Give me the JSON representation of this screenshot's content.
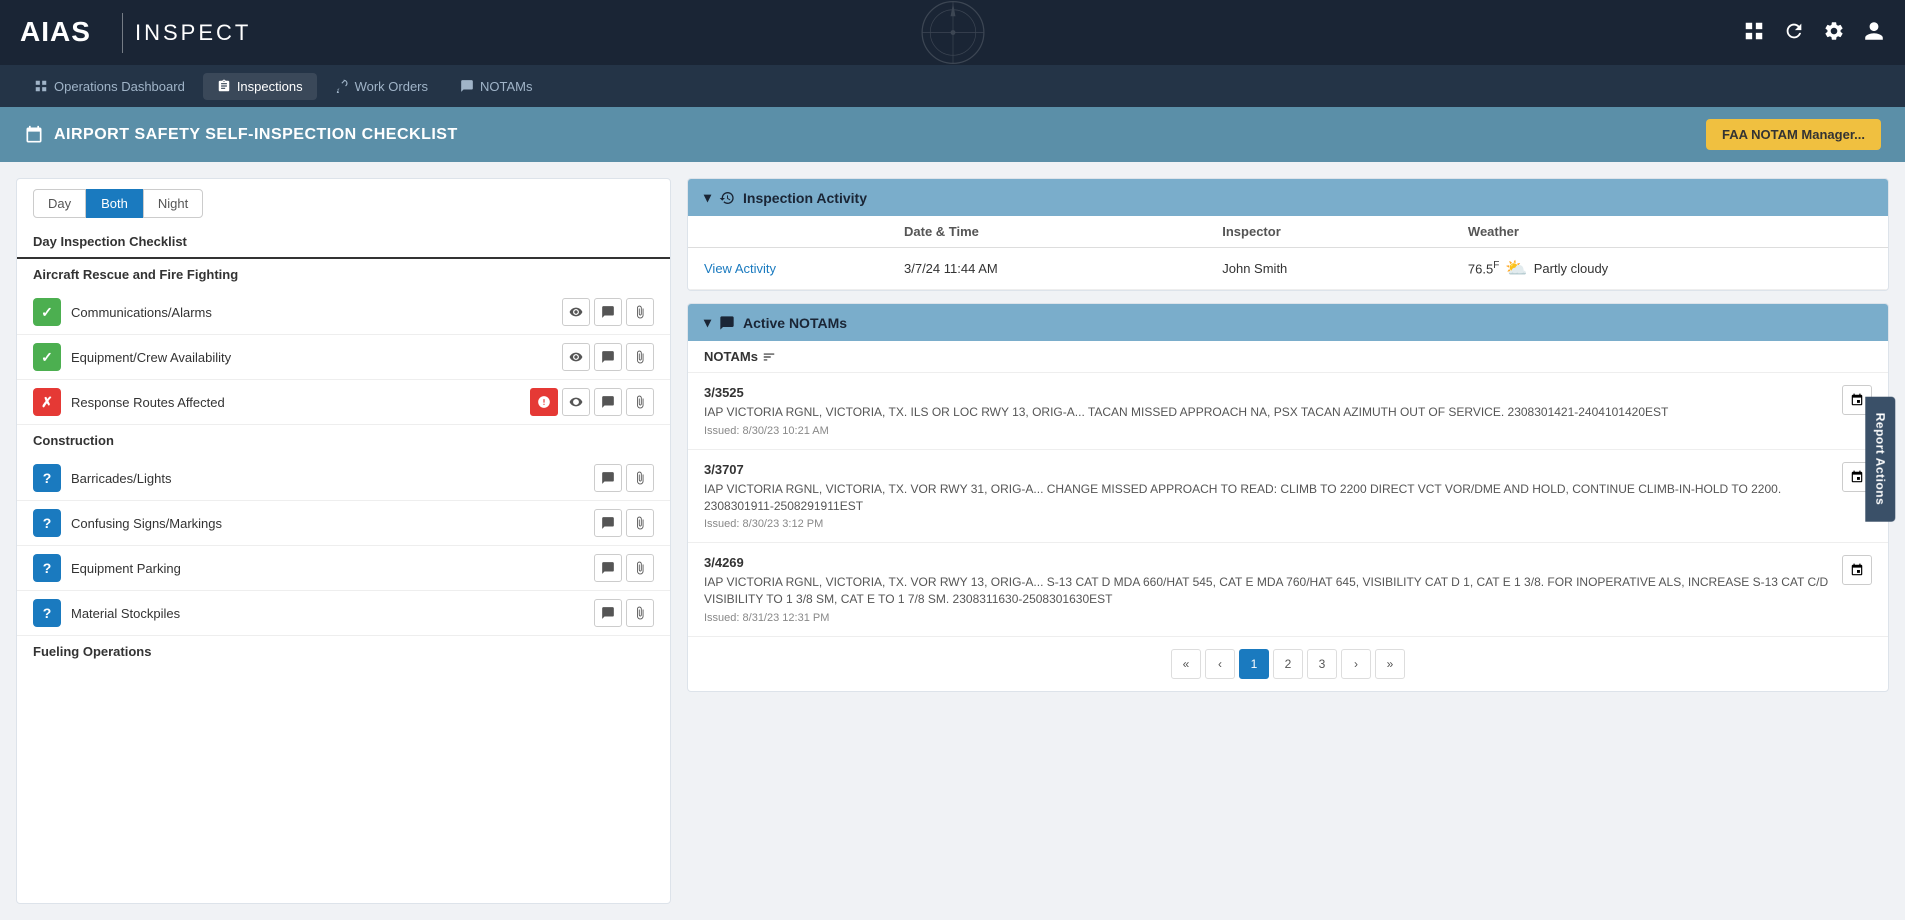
{
  "app": {
    "logo": "AIAS",
    "product": "INSPECT"
  },
  "nav": {
    "items": [
      {
        "id": "operations",
        "label": "Operations Dashboard",
        "icon": "grid-icon",
        "active": false
      },
      {
        "id": "inspections",
        "label": "Inspections",
        "icon": "clipboard-icon",
        "active": true
      },
      {
        "id": "workorders",
        "label": "Work Orders",
        "icon": "wrench-icon",
        "active": false
      },
      {
        "id": "notams",
        "label": "NOTAMs",
        "icon": "chat-icon",
        "active": false
      }
    ]
  },
  "page_header": {
    "title": "AIRPORT SAFETY SELF-INSPECTION CHECKLIST",
    "faa_btn": "FAA NOTAM Manager..."
  },
  "checklist": {
    "filter_buttons": [
      {
        "id": "day",
        "label": "Day",
        "active": false
      },
      {
        "id": "both",
        "label": "Both",
        "active": true
      },
      {
        "id": "night",
        "label": "Night",
        "active": false
      }
    ],
    "title": "Day Inspection Checklist",
    "sections": [
      {
        "id": "arff",
        "label": "Aircraft Rescue and Fire Fighting",
        "items": [
          {
            "id": "comm-alarms",
            "label": "Communications/Alarms",
            "status": "pass",
            "status_symbol": "✓"
          },
          {
            "id": "equip-crew",
            "label": "Equipment/Crew Availability",
            "status": "pass",
            "status_symbol": "✓"
          },
          {
            "id": "response-routes",
            "label": "Response Routes Affected",
            "status": "fail",
            "status_symbol": "✗"
          }
        ]
      },
      {
        "id": "construction",
        "label": "Construction",
        "items": [
          {
            "id": "barricades",
            "label": "Barricades/Lights",
            "status": "unknown",
            "status_symbol": "?"
          },
          {
            "id": "confusing-signs",
            "label": "Confusing Signs/Markings",
            "status": "unknown",
            "status_symbol": "?"
          },
          {
            "id": "equip-parking",
            "label": "Equipment Parking",
            "status": "unknown",
            "status_symbol": "?"
          },
          {
            "id": "material-stockpiles",
            "label": "Material Stockpiles",
            "status": "unknown",
            "status_symbol": "?"
          }
        ]
      },
      {
        "id": "fueling",
        "label": "Fueling Operations"
      }
    ]
  },
  "inspection_activity": {
    "section_title": "Inspection Activity",
    "columns": [
      "Date & Time",
      "Inspector",
      "Weather"
    ],
    "rows": [
      {
        "link_label": "View Activity",
        "date_time": "3/7/24 11:44 AM",
        "inspector": "John Smith",
        "temperature": "76.5",
        "temp_unit": "F",
        "weather_desc": "Partly cloudy"
      }
    ]
  },
  "active_notams": {
    "section_title": "Active NOTAMs",
    "filter_label": "NOTAMs",
    "notams": [
      {
        "id": "3/3525",
        "text": "IAP VICTORIA RGNL, VICTORIA, TX. ILS OR LOC RWY 13, ORIG-A... TACAN MISSED APPROACH NA, PSX TACAN AZIMUTH OUT OF SERVICE. 2308301421-2404101420EST",
        "issued": "Issued: 8/30/23 10:21 AM"
      },
      {
        "id": "3/3707",
        "text": "IAP VICTORIA RGNL, VICTORIA, TX. VOR RWY 31, ORIG-A... CHANGE MISSED APPROACH TO READ: CLIMB TO 2200 DIRECT VCT VOR/DME AND HOLD, CONTINUE CLIMB-IN-HOLD TO 2200. 2308301911-2508291911EST",
        "issued": "Issued: 8/30/23 3:12 PM"
      },
      {
        "id": "3/4269",
        "text": "IAP VICTORIA RGNL, VICTORIA, TX. VOR RWY 13, ORIG-A... S-13 CAT D MDA 660/HAT 545, CAT E MDA 760/HAT 645, VISIBILITY CAT D 1, CAT E 1 3/8. FOR INOPERATIVE ALS, INCREASE S-13 CAT C/D VISIBILITY TO 1 3/8 SM, CAT E TO 1 7/8 SM. 2308311630-2508301630EST",
        "issued": "Issued: 8/31/23 12:31 PM"
      }
    ],
    "pagination": {
      "first": "«",
      "prev": "‹",
      "pages": [
        1,
        2,
        3
      ],
      "current_page": 1,
      "next": "›",
      "last": "»"
    }
  },
  "report_actions": {
    "label": "Report Actions"
  }
}
